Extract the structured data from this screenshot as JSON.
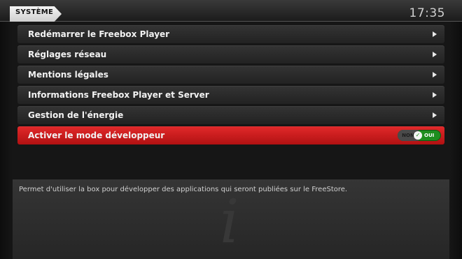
{
  "header": {
    "section_title": "SYSTÈME",
    "clock": "17:35"
  },
  "menu": {
    "items": [
      {
        "label": "Redémarrer le Freebox Player"
      },
      {
        "label": "Réglages réseau"
      },
      {
        "label": "Mentions légales"
      },
      {
        "label": "Informations Freebox Player et Server"
      },
      {
        "label": "Gestion de l'énergie"
      },
      {
        "label": "Activer le mode développeur",
        "selected": true
      }
    ],
    "toggle": {
      "off_label": "NON",
      "on_label": "OUI",
      "state": "on",
      "check_glyph": "✓"
    }
  },
  "info": {
    "description": "Permet d'utiliser la box pour développer des applications qui seront publiées sur le FreeStore.",
    "icon_glyph": "i"
  },
  "colors": {
    "accent_red": "#d01c1d",
    "toggle_green": "#1e8e1e",
    "background": "#161616"
  }
}
